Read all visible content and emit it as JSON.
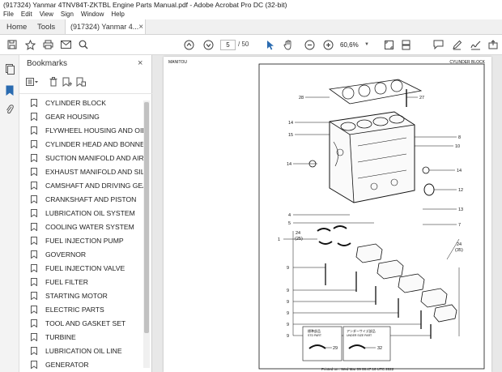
{
  "window": {
    "title": "(917324) Yanmar 4TNV84T-ZKTBL Engine Parts Manual.pdf - Adobe Acrobat Pro DC (32-bit)"
  },
  "menu": [
    "File",
    "Edit",
    "View",
    "Sign",
    "Window",
    "Help"
  ],
  "tabs": {
    "home": "Home",
    "tools": "Tools",
    "document": "(917324) Yanmar 4...",
    "close_glyph": "×"
  },
  "toolbar": {
    "page_current": "5",
    "page_total": "/ 50",
    "zoom": "60,6%"
  },
  "bookmarks": {
    "title": "Bookmarks",
    "close_glyph": "×",
    "items": [
      "CYLINDER BLOCK",
      "GEAR HOUSING",
      "FLYWHEEL HOUSING AND OIL SUMP",
      "CYLINDER HEAD AND BONNET",
      "SUCTION MANIFOLD AND AIR CLEANER",
      "EXHAUST MANIFOLD AND SILENCER",
      "CAMSHAFT AND DRIVING GEAR",
      "CRANKSHAFT AND PISTON",
      "LUBRICATION OIL SYSTEM",
      "COOLING WATER SYSTEM",
      "FUEL INJECTION PUMP",
      "GOVERNOR",
      "FUEL INJECTION VALVE",
      "FUEL FILTER",
      "STARTING MOTOR",
      "ELECTRIC PARTS",
      "TOOL AND GASKET SET",
      "TURBINE",
      "LUBRICATION OIL LINE",
      "GENERATOR"
    ]
  },
  "page": {
    "header_left": "MANITOU",
    "header_right": "CYLINDER BLOCK",
    "footer": "Printed on : Wed Mar 09 08:47:16 UTC 2022",
    "callouts": [
      "28",
      "27",
      "14",
      "15",
      "8",
      "10",
      "14",
      "14",
      "12",
      "11",
      "13",
      "4",
      "5",
      "7",
      "1",
      "24",
      "(25)",
      "24",
      "(35)",
      "9",
      "9",
      "9",
      "9",
      "9",
      "9",
      "29",
      "32"
    ],
    "boxes": {
      "left_title": "標準部品",
      "left_sub": "STD PART",
      "right_title": "アンダーサイズ部品",
      "right_sub": "UNDER SIZE PART"
    }
  },
  "colors": {
    "accent": "#2a6bb0",
    "chrome": "#f0f0f0",
    "doc_background": "#e8e8e8"
  },
  "icons": {
    "rail": [
      "page-thumbnails-icon",
      "bookmark-icon",
      "attachment-icon"
    ],
    "toolbar": [
      "save-icon",
      "bookmark-star-icon",
      "print-icon",
      "email-icon",
      "search-icon",
      "page-up-icon",
      "page-down-icon",
      "select-cursor-icon",
      "hand-icon",
      "zoom-out-icon",
      "zoom-in-icon",
      "fit-page-icon",
      "scroll-mode-icon",
      "comment-icon",
      "pen-icon",
      "sign-icon",
      "share-icon"
    ]
  }
}
